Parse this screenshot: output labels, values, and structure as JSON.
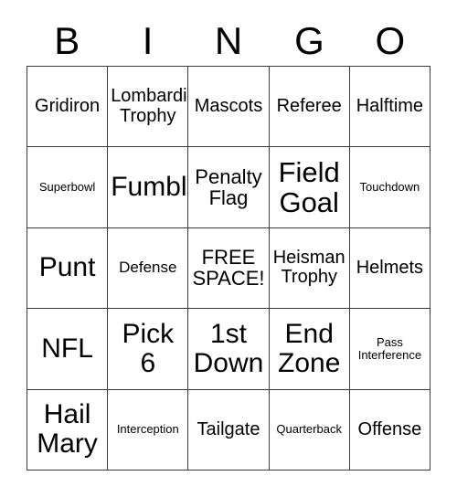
{
  "card": {
    "title": "BINGO",
    "headers": [
      "B",
      "I",
      "N",
      "G",
      "O"
    ],
    "rows": [
      [
        {
          "label": "Gridiron",
          "size": "md"
        },
        {
          "label": "Lombardi\nTrophy",
          "size": "md"
        },
        {
          "label": "Mascots",
          "size": "md"
        },
        {
          "label": "Referee",
          "size": "md"
        },
        {
          "label": "Halftime",
          "size": "md"
        }
      ],
      [
        {
          "label": "Superbowl",
          "size": "xs"
        },
        {
          "label": "Fumble",
          "size": "xl"
        },
        {
          "label": "Penalty\nFlag",
          "size": "lg"
        },
        {
          "label": "Field\nGoal",
          "size": "xxl"
        },
        {
          "label": "Touchdown",
          "size": "xs"
        }
      ],
      [
        {
          "label": "Punt",
          "size": "xl"
        },
        {
          "label": "Defense",
          "size": "sm"
        },
        {
          "label": "FREE\nSPACE!",
          "size": "lg"
        },
        {
          "label": "Heisman\nTrophy",
          "size": "md"
        },
        {
          "label": "Helmets",
          "size": "md"
        }
      ],
      [
        {
          "label": "NFL",
          "size": "xl"
        },
        {
          "label": "Pick\n6",
          "size": "xl"
        },
        {
          "label": "1st\nDown",
          "size": "xl"
        },
        {
          "label": "End\nZone",
          "size": "xl"
        },
        {
          "label": "Pass\nInterference",
          "size": "xs"
        }
      ],
      [
        {
          "label": "Hail\nMary",
          "size": "xl"
        },
        {
          "label": "Interception",
          "size": "xs"
        },
        {
          "label": "Tailgate",
          "size": "md"
        },
        {
          "label": "Quarterback",
          "size": "xs"
        },
        {
          "label": "Offense",
          "size": "md"
        }
      ]
    ],
    "free_space_label": "FREE SPACE!",
    "colors": {
      "background": "#ffffff",
      "text": "#000000",
      "grid_line": "#3a3a3a"
    }
  }
}
